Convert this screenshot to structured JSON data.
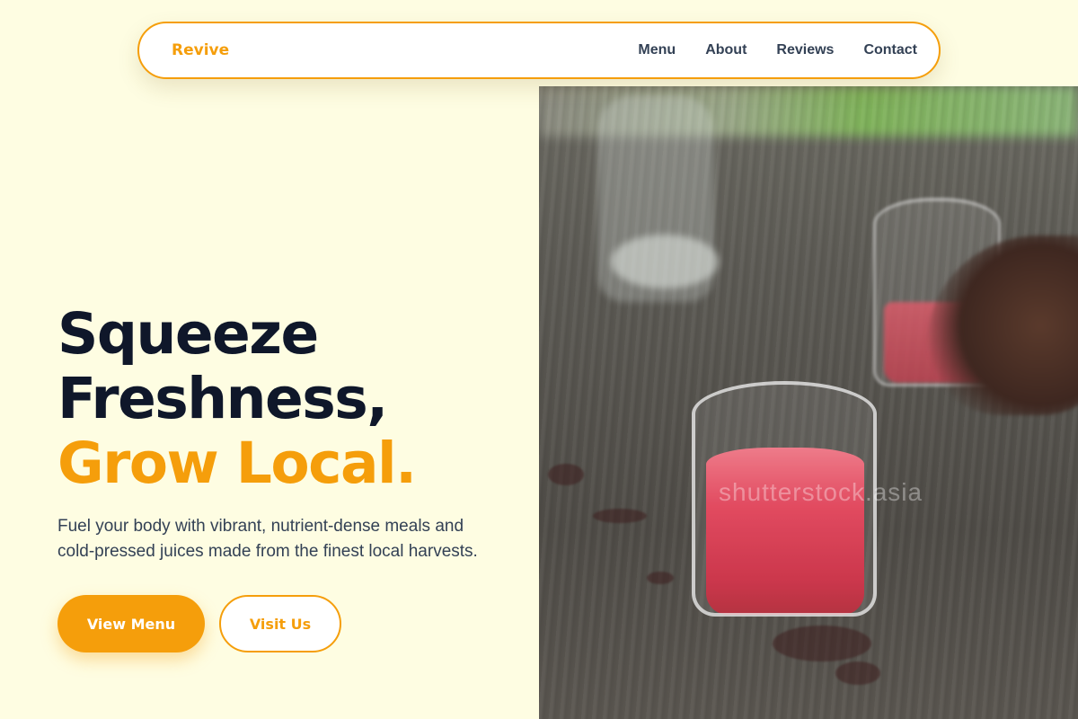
{
  "nav": {
    "brand": "Revive",
    "links": [
      {
        "label": "Menu"
      },
      {
        "label": "About"
      },
      {
        "label": "Reviews"
      },
      {
        "label": "Contact"
      }
    ]
  },
  "hero": {
    "headline_line1": "Squeeze",
    "headline_line2": "Freshness,",
    "headline_accent": "Grow Local.",
    "subtext": "Fuel your body with vibrant, nutrient-dense meals and cold-pressed juices made from the finest local harvests.",
    "primary_button": "View Menu",
    "secondary_button": "Visit Us"
  },
  "image": {
    "watermark": "shutterstock.asia",
    "subject": "glasses of red juice on a wooden table"
  },
  "colors": {
    "background": "#fefde2",
    "accent": "#f59e0b",
    "heading": "#0f172a",
    "body_text": "#334155"
  }
}
